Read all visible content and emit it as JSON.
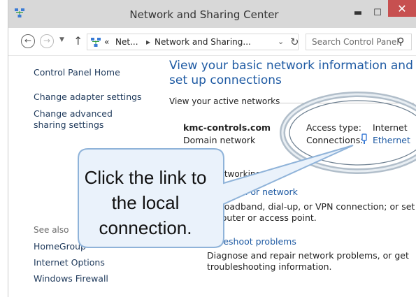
{
  "window": {
    "title": "Network and Sharing Center"
  },
  "addressbar": {
    "overflow": "«",
    "crumb1": "Net...",
    "crumb2": "Network and Sharing...",
    "search_placeholder": "Search Control Panel"
  },
  "leftnav": {
    "home": "Control Panel Home",
    "adapter": "Change adapter settings",
    "advanced": "Change advanced sharing settings",
    "see_also": "See also",
    "homegroup": "HomeGroup",
    "internet_options": "Internet Options",
    "firewall": "Windows Firewall"
  },
  "main": {
    "heading": "View your basic network information and set up connections",
    "active_label": "View your active networks",
    "network": {
      "name": "kmc-controls.com",
      "type": "Domain network",
      "access_label": "Access type:",
      "access_value": "Internet",
      "connections_label": "Connections:",
      "connection_link": "Ethernet"
    },
    "change_label": "...etworking s...",
    "setup_link": "...nection or network",
    "setup_desc": "...broadband, dial-up, or VPN connection; or set ... router or access point.",
    "trouble_link": "...bleshoot problems",
    "trouble_desc": "Diagnose and repair network problems, or get troubleshooting information."
  },
  "callout": {
    "text": "Click the link to the local connection."
  },
  "colors": {
    "link": "#1e5aa3",
    "close": "#c75050",
    "titlebar": "#d8d8d8"
  }
}
